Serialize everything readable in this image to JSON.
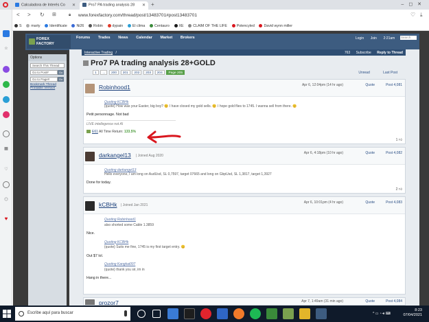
{
  "browser": {
    "tabs": [
      {
        "title": "Calculadora de Interés Co",
        "favicon_color": "#2a7ae2"
      },
      {
        "title": "Pro7 PA trading analysis 28",
        "favicon_color": "#3d5c80"
      }
    ],
    "url": "www.forexfactory.com/thread/post/13483701#post13483701",
    "bookmarks": [
      "S",
      "marty",
      "Identificate",
      "Ni26",
      "Robin",
      "dypain",
      "El clima",
      "Centauro",
      "XE",
      "CLAIM OF THE LIFE",
      "Potencyled",
      "David wynn miller"
    ]
  },
  "forum": {
    "logo": {
      "line1": "FOREX",
      "line2": "FACTORY"
    },
    "nav": [
      "Forums",
      "Trades",
      "News",
      "Calendar",
      "Market",
      "Brokers"
    ],
    "right": {
      "login": "Login",
      "join": "Join",
      "time": "2:21am",
      "search": "Search"
    },
    "left_panel": {
      "title": "Options",
      "search_thread": "Search This Thread",
      "go_to_post": "Go to Post#",
      "go_to_page": "Go to Page#",
      "go": "Go",
      "bookmark": "Bookmark Thread",
      "printable": "Printable Version"
    },
    "breadcrumb": "Interactive Trading",
    "breadcrumb_sep": "/",
    "subhead_right": {
      "count": "763",
      "subscribe": "Subscribe",
      "reply": "Reply to Thread"
    },
    "thread_title": "Pro7 PA trading analysis 28+GOLD",
    "pages": [
      "1",
      "...",
      "200",
      "201",
      "202",
      "203",
      "204",
      "Page 205"
    ],
    "sort": {
      "unread": "Unread",
      "last_post": "Last Post"
    },
    "posts": [
      {
        "username": "Robinhood1",
        "joined": "",
        "date": "Apr 6, 12:04pm (14 hr ago)",
        "quote_label": "Quote",
        "post_number": "Post 4,081",
        "quote_header": "Quoting KCBHk",
        "quote_text": "{quote} How was your Easter, big boy? 😊 I have closed my gold sells. 😊 I hope gold flies to 1745. I wanna sell from there. 😊",
        "body": "Petit personnage. Not bad",
        "signature_title": "LIVE intellegence not AI",
        "signature_line": "All Time Return:",
        "signature_badge": "E61",
        "signature_pct": "133.5%",
        "likes": "1"
      },
      {
        "username": "darkangel13",
        "joined": "| Joined Aug 2020",
        "date": "Apr 6, 4:18pm (10 hr ago)",
        "quote_label": "Quote",
        "post_number": "Post 4,082",
        "quote_header": "Quoting darkangel13",
        "quote_text": "Hello everyone, I am long on AudUsd, SL 0,7597, target 07665 and long on GbpUsd, SL 1,3817, target 1,3927",
        "body": "Done for today.",
        "likes": "2"
      },
      {
        "username": "kCBHk",
        "joined": "| Joined Jan 2021",
        "date": "Apr 6, 10:01pm (4 hr ago)",
        "quote_label": "Quote",
        "post_number": "Post 4,083",
        "quotes": [
          {
            "header": "Quoting Robinhood1",
            "text": "also shorted some Cable 1.3859"
          },
          {
            "header": "Quoting KCBHk",
            "text": "{quote} Suits me fine, 1745 is my first target entry. 😊"
          },
          {
            "header": "Quoting Kangkai007",
            "text": "{quote} thank you sir, im in"
          }
        ],
        "bodies": [
          "Nice.",
          "Out $7 lol.",
          "Hang in there..."
        ]
      },
      {
        "username": "prozor7",
        "date": "Apr 7, 1:49am (31 min ago)",
        "quote_label": "Quote",
        "post_number": "Post 4,084"
      }
    ]
  },
  "taskbar": {
    "search_placeholder": "Escribe aquí para buscar",
    "time": "8:23",
    "date": "07/04/2021"
  },
  "colors": {
    "ff_header": "#3d5c80",
    "accent_green": "#4a9b3a",
    "arrow_red": "#d9161e"
  }
}
